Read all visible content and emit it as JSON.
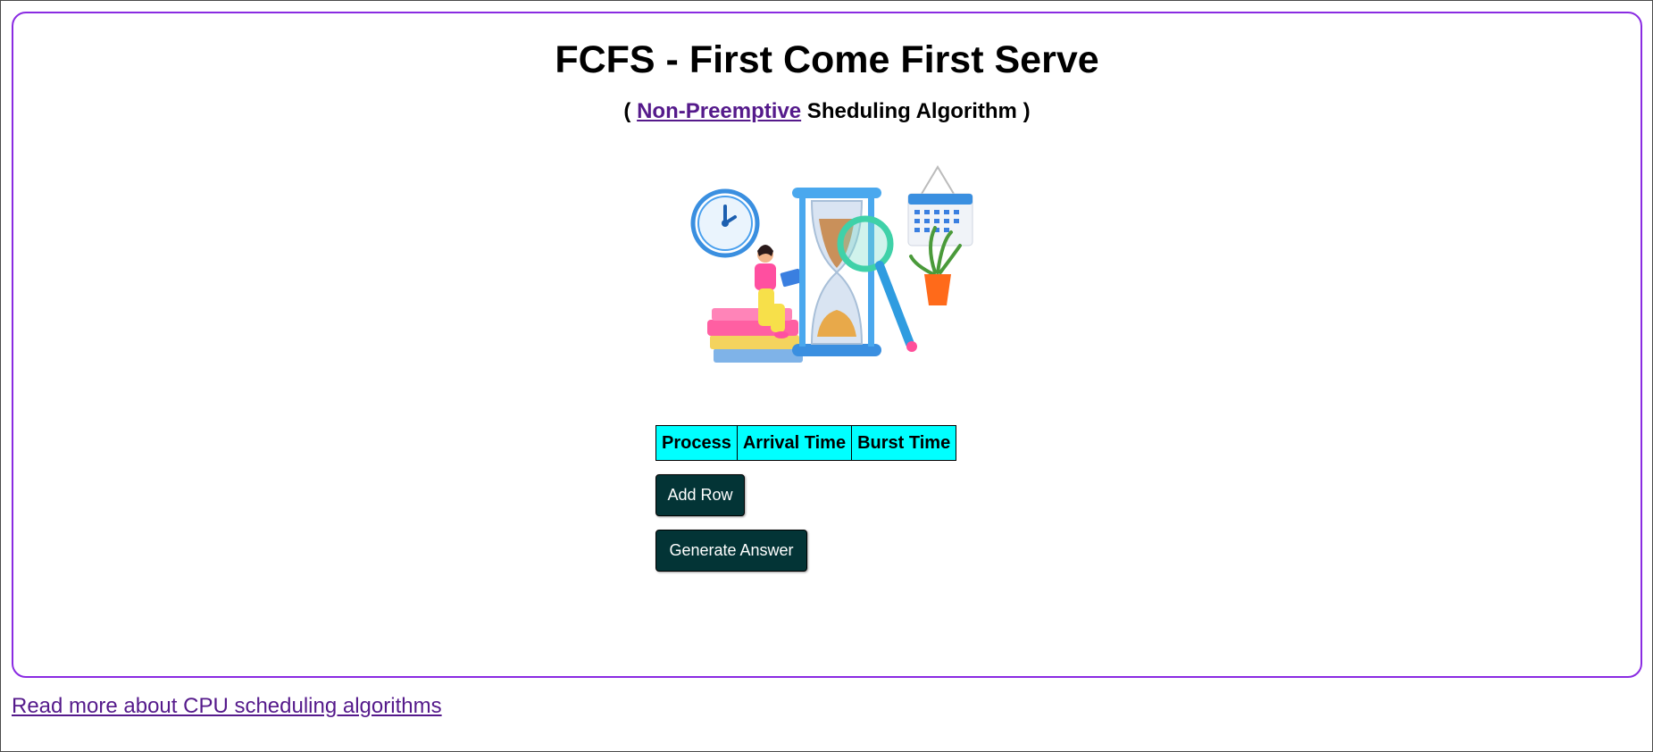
{
  "header": {
    "title": "FCFS - First Come First Serve",
    "subtitle_open": "( ",
    "subtitle_link": "Non-Preemptive",
    "subtitle_rest": " Sheduling Algorithm )"
  },
  "table": {
    "columns": [
      "Process",
      "Arrival Time",
      "Burst Time"
    ],
    "header_bg": "#00ffff"
  },
  "buttons": {
    "add_row": "Add Row",
    "generate": "Generate Answer",
    "bg_color": "#033436"
  },
  "footer": {
    "link_text": "Read more about CPU scheduling algorithms"
  },
  "colors": {
    "card_border": "#8a2be2",
    "link": "#551a8b"
  },
  "illustration": {
    "icons": [
      "clock-icon",
      "person-on-books-icon",
      "hourglass-icon",
      "magnifier-icon",
      "calendar-icon",
      "plant-icon"
    ]
  }
}
